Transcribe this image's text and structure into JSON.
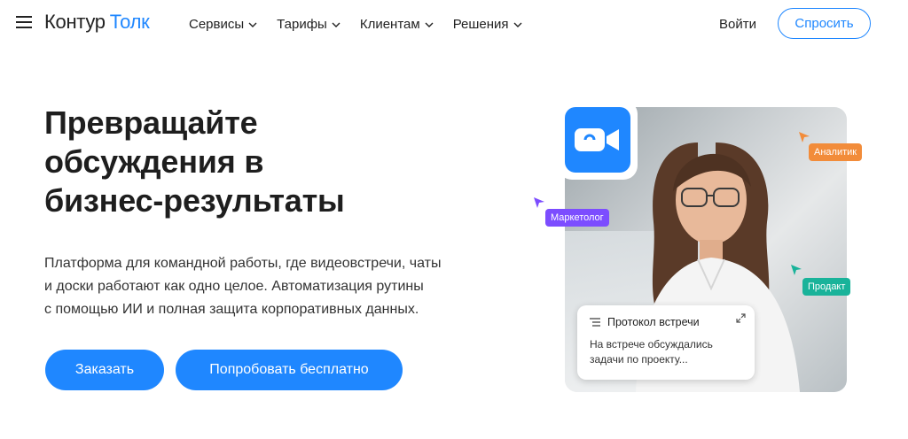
{
  "header": {
    "logo_brand": "Контур",
    "logo_product": "Толк",
    "nav": [
      {
        "label": "Сервисы"
      },
      {
        "label": "Тарифы"
      },
      {
        "label": "Клиентам"
      },
      {
        "label": "Решения"
      }
    ],
    "login_label": "Войти",
    "ask_label": "Спросить",
    "accent_color": "#1f87ff"
  },
  "hero": {
    "title_lines": [
      "Превращайте",
      "обсуждения в",
      "бизнес-результаты"
    ],
    "description_lines": [
      "Платформа для командной работы, где видеовстречи, чаты",
      "и доски работают как одно целое. Автоматизация рутины",
      "с помощью ИИ и полная защита корпоративных данных."
    ],
    "order_label": "Заказать",
    "try_label": "Попробовать бесплатно"
  },
  "illustration": {
    "tags": {
      "analyst": "Аналитик",
      "marketer": "Маркетолог",
      "product": "Продакт"
    },
    "tag_colors": {
      "analyst": "#f28c3a",
      "marketer": "#7c4dff",
      "product": "#19b39a"
    },
    "protocol": {
      "title": "Протокол встречи",
      "body_lines": [
        "На встрече обсуждались",
        "задачи по проекту..."
      ]
    },
    "icons": [
      "video-camera-icon",
      "list-icon",
      "expand-icon",
      "cursor-icon"
    ]
  }
}
